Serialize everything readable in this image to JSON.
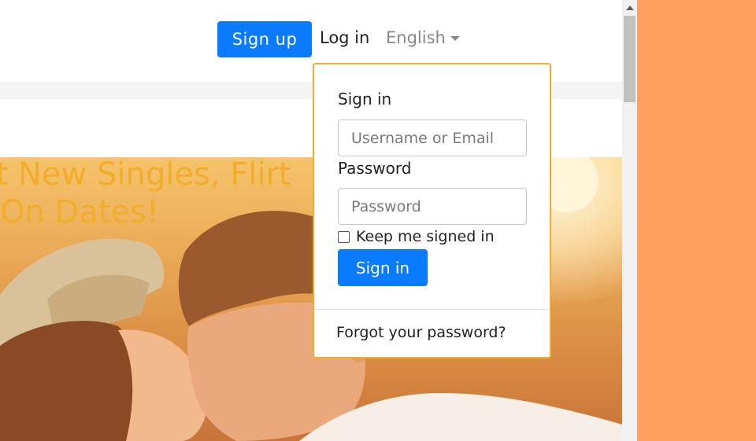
{
  "navbar": {
    "signup_label": "Sign up",
    "login_label": "Log in",
    "language_label": "English"
  },
  "hero": {
    "heading_line1": "et New Singles, Flirt",
    "heading_line2": "On Dates!"
  },
  "login_dropdown": {
    "title": "Sign in",
    "username_placeholder": "Username or Email",
    "password_label": "Password",
    "password_placeholder": "Password",
    "keep_signed_in_label": "Keep me signed in",
    "signin_label": "Sign in",
    "forgot_label": "Forgot your password?"
  },
  "colors": {
    "primary": "#0a7bff",
    "accent": "#f0ae2a",
    "side_background": "#ffa060"
  },
  "icons": {
    "language_caret": "caret-down-icon",
    "scroll_up": "arrow-up-icon"
  }
}
